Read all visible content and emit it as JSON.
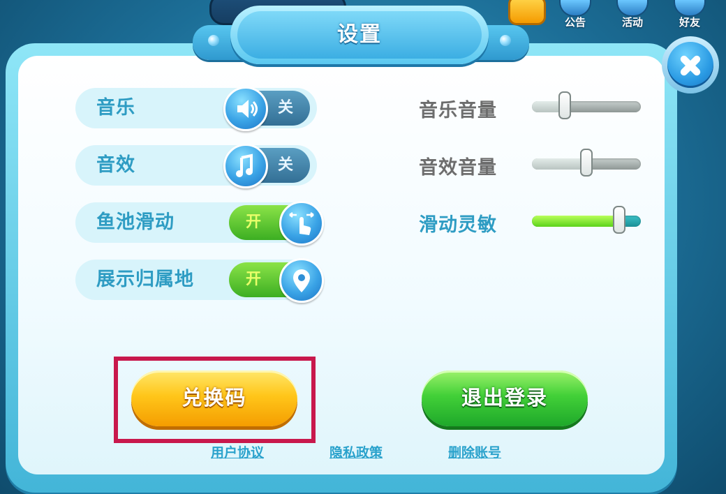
{
  "dialog": {
    "title": "设置"
  },
  "hud": {
    "notice": "公告",
    "events": "活动",
    "friends": "好友"
  },
  "toggles": [
    {
      "label": "音乐",
      "state": "关",
      "icon": "speaker-icon"
    },
    {
      "label": "音效",
      "state": "关",
      "icon": "music-note-icon"
    },
    {
      "label": "鱼池滑动",
      "state": "开",
      "icon": "swipe-hand-icon"
    },
    {
      "label": "展示归属地",
      "state": "开",
      "icon": "location-pin-icon"
    }
  ],
  "sliders": [
    {
      "label": "音乐音量",
      "value": 0.3
    },
    {
      "label": "音效音量",
      "value": 0.5
    },
    {
      "label": "滑动灵敏",
      "value": 0.8
    }
  ],
  "buttons": {
    "redeem": "兑换码",
    "logout": "退出登录"
  },
  "links": {
    "user_agreement": "用户协议",
    "privacy_policy": "隐私政策",
    "delete_account": "删除账号"
  },
  "colors": {
    "label_blue": "#2e9cc3",
    "label_gray": "#6d6d6d",
    "highlight_frame": "#c8184c"
  }
}
